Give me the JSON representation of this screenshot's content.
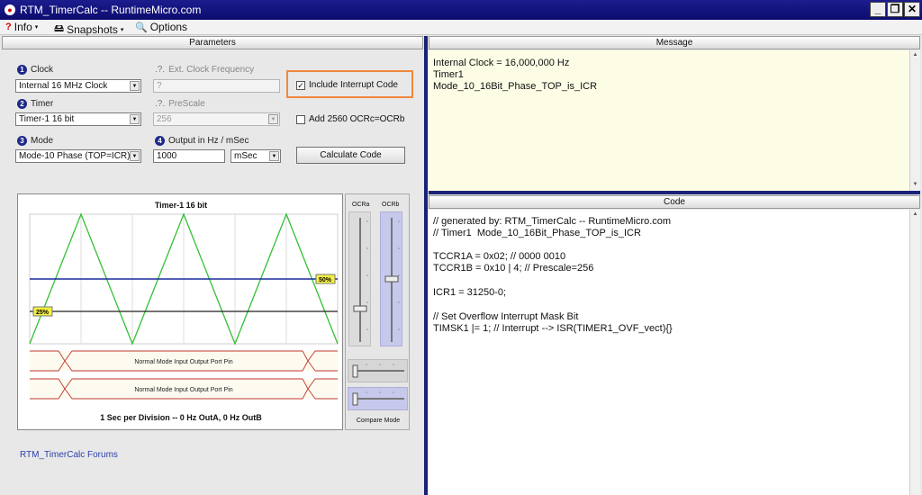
{
  "window": {
    "title": "RTM_TimerCalc -- RuntimeMicro.com",
    "minimize": "_",
    "restore": "❐",
    "close": "✕"
  },
  "menu": [
    {
      "label": "Info",
      "icon": "?"
    },
    {
      "label": "Snapshots",
      "icon": "🖴"
    },
    {
      "label": "Options",
      "icon": "🔍"
    }
  ],
  "parameters": {
    "header": "Parameters",
    "clock": {
      "label": "Clock",
      "num": "1",
      "value": "Internal 16 MHz Clock"
    },
    "ext_clock": {
      "label": "Ext. Clock Frequency",
      "prefix": ".?.",
      "value": "?"
    },
    "include_interrupt": {
      "label": "Include Interrupt Code",
      "checked": "✓"
    },
    "timer": {
      "label": "Timer",
      "num": "2",
      "value": "Timer-1 16 bit"
    },
    "prescale": {
      "label": "PreScale",
      "prefix": ".?.",
      "value": "256"
    },
    "add2560": {
      "label": "Add 2560 OCRc=OCRb"
    },
    "mode": {
      "label": "Mode",
      "num": "3",
      "value": "Mode-10 Phase (TOP=ICR)"
    },
    "output": {
      "label": "Output in Hz / mSec",
      "num": "4",
      "value": "1000",
      "unit": "mSec"
    },
    "calculate_label": "Calculate  Code"
  },
  "chart": {
    "title": "Timer-1 16 bit",
    "footer": "1 Sec per Division -- 0 Hz OutA,  0 Hz OutB",
    "tag_high": "50%",
    "tag_low": "25%",
    "signal_a": "Normal Mode  Input Output Port Pin",
    "signal_b": "Normal Mode  Input Output Port Pin",
    "colors": {
      "wave": "#33c033",
      "ocra": "#1a2c9c",
      "ocrb": "#222222",
      "signal": "#c0392b"
    }
  },
  "sliders": {
    "ocra_label": "OCRa",
    "ocrb_label": "OCRb",
    "compare_mode_label": "Compare Mode"
  },
  "forums_label": "RTM_TimerCalc  Forums",
  "message": {
    "header": "Message",
    "lines": [
      "Internal Clock = 16,000,000 Hz",
      "Timer1",
      "Mode_10_16Bit_Phase_TOP_is_ICR"
    ]
  },
  "code": {
    "header": "Code",
    "lines": [
      "// generated by: RTM_TimerCalc -- RuntimeMicro.com",
      "// Timer1  Mode_10_16Bit_Phase_TOP_is_ICR",
      "",
      "TCCR1A = 0x02; // 0000 0010",
      "TCCR1B = 0x10 | 4; // Prescale=256",
      "",
      "ICR1 = 31250-0;",
      "",
      "// Set Overflow Interrupt Mask Bit",
      "TIMSK1 |= 1; // Interrupt --> ISR(TIMER1_OVF_vect){}"
    ]
  }
}
